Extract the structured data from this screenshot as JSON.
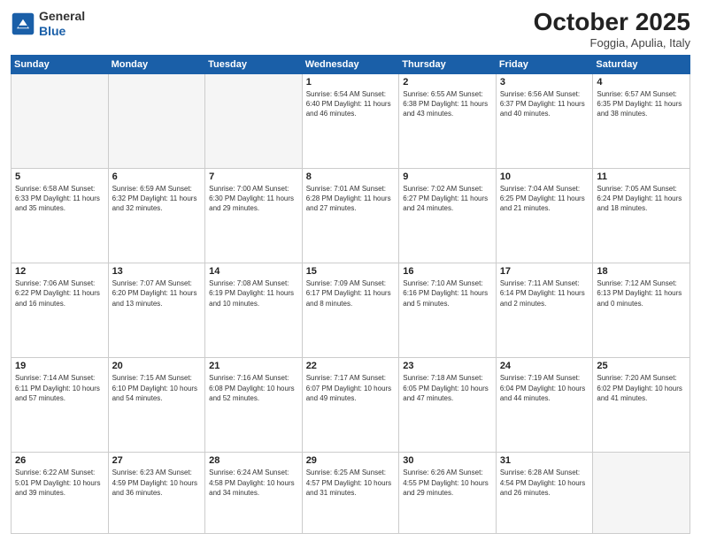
{
  "header": {
    "logo_line1": "General",
    "logo_line2": "Blue",
    "month": "October 2025",
    "location": "Foggia, Apulia, Italy"
  },
  "weekdays": [
    "Sunday",
    "Monday",
    "Tuesday",
    "Wednesday",
    "Thursday",
    "Friday",
    "Saturday"
  ],
  "weeks": [
    [
      {
        "day": "",
        "info": ""
      },
      {
        "day": "",
        "info": ""
      },
      {
        "day": "",
        "info": ""
      },
      {
        "day": "1",
        "info": "Sunrise: 6:54 AM\nSunset: 6:40 PM\nDaylight: 11 hours\nand 46 minutes."
      },
      {
        "day": "2",
        "info": "Sunrise: 6:55 AM\nSunset: 6:38 PM\nDaylight: 11 hours\nand 43 minutes."
      },
      {
        "day": "3",
        "info": "Sunrise: 6:56 AM\nSunset: 6:37 PM\nDaylight: 11 hours\nand 40 minutes."
      },
      {
        "day": "4",
        "info": "Sunrise: 6:57 AM\nSunset: 6:35 PM\nDaylight: 11 hours\nand 38 minutes."
      }
    ],
    [
      {
        "day": "5",
        "info": "Sunrise: 6:58 AM\nSunset: 6:33 PM\nDaylight: 11 hours\nand 35 minutes."
      },
      {
        "day": "6",
        "info": "Sunrise: 6:59 AM\nSunset: 6:32 PM\nDaylight: 11 hours\nand 32 minutes."
      },
      {
        "day": "7",
        "info": "Sunrise: 7:00 AM\nSunset: 6:30 PM\nDaylight: 11 hours\nand 29 minutes."
      },
      {
        "day": "8",
        "info": "Sunrise: 7:01 AM\nSunset: 6:28 PM\nDaylight: 11 hours\nand 27 minutes."
      },
      {
        "day": "9",
        "info": "Sunrise: 7:02 AM\nSunset: 6:27 PM\nDaylight: 11 hours\nand 24 minutes."
      },
      {
        "day": "10",
        "info": "Sunrise: 7:04 AM\nSunset: 6:25 PM\nDaylight: 11 hours\nand 21 minutes."
      },
      {
        "day": "11",
        "info": "Sunrise: 7:05 AM\nSunset: 6:24 PM\nDaylight: 11 hours\nand 18 minutes."
      }
    ],
    [
      {
        "day": "12",
        "info": "Sunrise: 7:06 AM\nSunset: 6:22 PM\nDaylight: 11 hours\nand 16 minutes."
      },
      {
        "day": "13",
        "info": "Sunrise: 7:07 AM\nSunset: 6:20 PM\nDaylight: 11 hours\nand 13 minutes."
      },
      {
        "day": "14",
        "info": "Sunrise: 7:08 AM\nSunset: 6:19 PM\nDaylight: 11 hours\nand 10 minutes."
      },
      {
        "day": "15",
        "info": "Sunrise: 7:09 AM\nSunset: 6:17 PM\nDaylight: 11 hours\nand 8 minutes."
      },
      {
        "day": "16",
        "info": "Sunrise: 7:10 AM\nSunset: 6:16 PM\nDaylight: 11 hours\nand 5 minutes."
      },
      {
        "day": "17",
        "info": "Sunrise: 7:11 AM\nSunset: 6:14 PM\nDaylight: 11 hours\nand 2 minutes."
      },
      {
        "day": "18",
        "info": "Sunrise: 7:12 AM\nSunset: 6:13 PM\nDaylight: 11 hours\nand 0 minutes."
      }
    ],
    [
      {
        "day": "19",
        "info": "Sunrise: 7:14 AM\nSunset: 6:11 PM\nDaylight: 10 hours\nand 57 minutes."
      },
      {
        "day": "20",
        "info": "Sunrise: 7:15 AM\nSunset: 6:10 PM\nDaylight: 10 hours\nand 54 minutes."
      },
      {
        "day": "21",
        "info": "Sunrise: 7:16 AM\nSunset: 6:08 PM\nDaylight: 10 hours\nand 52 minutes."
      },
      {
        "day": "22",
        "info": "Sunrise: 7:17 AM\nSunset: 6:07 PM\nDaylight: 10 hours\nand 49 minutes."
      },
      {
        "day": "23",
        "info": "Sunrise: 7:18 AM\nSunset: 6:05 PM\nDaylight: 10 hours\nand 47 minutes."
      },
      {
        "day": "24",
        "info": "Sunrise: 7:19 AM\nSunset: 6:04 PM\nDaylight: 10 hours\nand 44 minutes."
      },
      {
        "day": "25",
        "info": "Sunrise: 7:20 AM\nSunset: 6:02 PM\nDaylight: 10 hours\nand 41 minutes."
      }
    ],
    [
      {
        "day": "26",
        "info": "Sunrise: 6:22 AM\nSunset: 5:01 PM\nDaylight: 10 hours\nand 39 minutes."
      },
      {
        "day": "27",
        "info": "Sunrise: 6:23 AM\nSunset: 4:59 PM\nDaylight: 10 hours\nand 36 minutes."
      },
      {
        "day": "28",
        "info": "Sunrise: 6:24 AM\nSunset: 4:58 PM\nDaylight: 10 hours\nand 34 minutes."
      },
      {
        "day": "29",
        "info": "Sunrise: 6:25 AM\nSunset: 4:57 PM\nDaylight: 10 hours\nand 31 minutes."
      },
      {
        "day": "30",
        "info": "Sunrise: 6:26 AM\nSunset: 4:55 PM\nDaylight: 10 hours\nand 29 minutes."
      },
      {
        "day": "31",
        "info": "Sunrise: 6:28 AM\nSunset: 4:54 PM\nDaylight: 10 hours\nand 26 minutes."
      },
      {
        "day": "",
        "info": ""
      }
    ]
  ]
}
